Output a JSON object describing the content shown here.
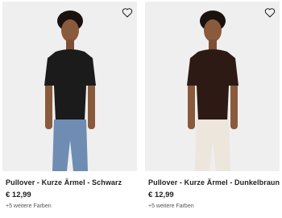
{
  "products": [
    {
      "title": "Pullover - Kurze Ärmel - Schwarz",
      "price": "€ 12,99",
      "more_colors": "+5 weitere Farben",
      "top_color": "#1b1b1b",
      "bottom_color": "#6f8db3",
      "favorite_icon": "heart-outline-icon"
    },
    {
      "title": "Pullover - Kurze Ärmel - Dunkelbraun",
      "price": "€ 12,99",
      "more_colors": "+5 weitere Farben",
      "top_color": "#2e1a14",
      "bottom_color": "#ece6dc",
      "favorite_icon": "heart-outline-icon"
    }
  ]
}
